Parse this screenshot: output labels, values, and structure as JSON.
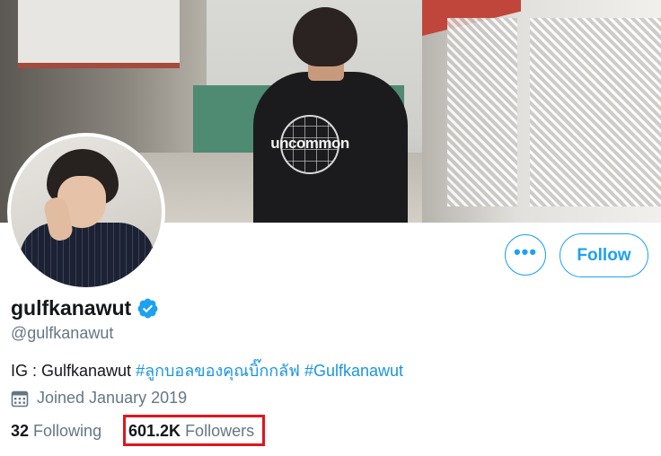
{
  "profile": {
    "display_name": "gulfkanawut",
    "handle": "@gulfkanawut",
    "verified": true,
    "bio_prefix": "IG : Gulfkanawut ",
    "bio_tags": [
      "#ลูกบอลของคุณบิ๊กกลัฟ",
      "#Gulfkanawut"
    ],
    "joined": "Joined January 2019",
    "banner_print_text": "uncommon"
  },
  "actions": {
    "follow_label": "Follow",
    "more_label": "•••"
  },
  "stats": {
    "following_count": "32",
    "following_label": "Following",
    "followers_count": "601.2K",
    "followers_label": "Followers"
  },
  "colors": {
    "accent": "#1da1f2",
    "hashtag": "#1b95e0",
    "highlight": "#e0161c",
    "muted_text": "#657786"
  },
  "icons": {
    "verified": "verified-badge-icon",
    "calendar": "calendar-icon",
    "more": "more-horizontal-icon"
  }
}
